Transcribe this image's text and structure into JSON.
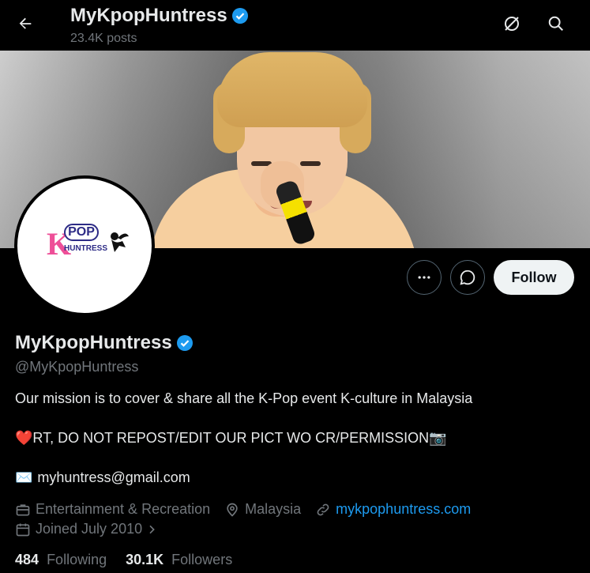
{
  "header": {
    "title": "MyKpopHuntress",
    "posts": "23.4K posts"
  },
  "banner": {
    "description": "Performer with bleached hair singing into a microphone"
  },
  "avatar": {
    "logo_k": "K",
    "logo_pop": "POP",
    "logo_huntress": "HUNTRESS"
  },
  "actions": {
    "follow_label": "Follow"
  },
  "profile": {
    "name": "MyKpopHuntress",
    "handle": "@MyKpopHuntress",
    "bio_line1": "Our mission is to cover & share all the K-Pop event K-culture in Malaysia",
    "bio_line2_emoji_left": "❤️",
    "bio_line2": "RT, DO NOT REPOST/EDIT OUR PICT WO CR/PERMISSION",
    "bio_line2_emoji_right": "📷",
    "bio_email_emoji": "✉️",
    "bio_email": "myhuntress@gmail.com",
    "category": "Entertainment & Recreation",
    "location": "Malaysia",
    "website": "mykpophuntress.com",
    "joined": "Joined July 2010"
  },
  "stats": {
    "following_count": "484",
    "following_label": "Following",
    "followers_count": "30.1K",
    "followers_label": "Followers"
  },
  "colors": {
    "background": "#000000",
    "accent": "#1d9bf0",
    "muted": "#71767b",
    "text": "#e7e9ea"
  }
}
